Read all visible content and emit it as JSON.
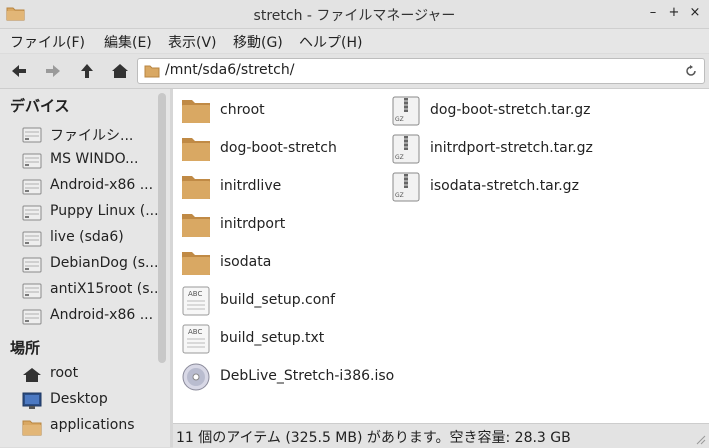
{
  "window": {
    "title": "stretch - ファイルマネージャー",
    "minimize_glyph": "–",
    "maximize_glyph": "+",
    "close_glyph": "×"
  },
  "menu": [
    {
      "label": "ファイル(F)"
    },
    {
      "label": "編集(E)"
    },
    {
      "label": "表示(V)"
    },
    {
      "label": "移動(G)"
    },
    {
      "label": "ヘルプ(H)"
    }
  ],
  "toolbar": {
    "icons": [
      "back-arrow-icon",
      "forward-arrow-icon",
      "up-arrow-icon",
      "home-icon"
    ],
    "path": "/mnt/sda6/stretch/"
  },
  "sidebar": {
    "devices_header": "デバイス",
    "devices": [
      {
        "label": "ファイルシ...",
        "icon": "drive-icon"
      },
      {
        "label": "MS WINDO...",
        "icon": "drive-icon"
      },
      {
        "label": "Android-x86 ...",
        "icon": "drive-icon"
      },
      {
        "label": "Puppy Linux (...",
        "icon": "drive-icon"
      },
      {
        "label": "live (sda6)",
        "icon": "drive-icon"
      },
      {
        "label": "DebianDog (s...",
        "icon": "drive-icon"
      },
      {
        "label": "antiX15root (s...",
        "icon": "drive-icon"
      },
      {
        "label": "Android-x86 ...",
        "icon": "drive-icon"
      }
    ],
    "places_header": "場所",
    "places": [
      {
        "label": "root",
        "icon": "home-icon"
      },
      {
        "label": "Desktop",
        "icon": "desktop-icon"
      },
      {
        "label": "applications",
        "icon": "folder-icon"
      }
    ]
  },
  "files": [
    {
      "name": "chroot",
      "type": "folder"
    },
    {
      "name": "dog-boot-stretch",
      "type": "folder"
    },
    {
      "name": "initrdlive",
      "type": "folder"
    },
    {
      "name": "initrdport",
      "type": "folder"
    },
    {
      "name": "isodata",
      "type": "folder"
    },
    {
      "name": "build_setup.conf",
      "type": "text"
    },
    {
      "name": "build_setup.txt",
      "type": "text"
    },
    {
      "name": "DebLive_Stretch-i386.iso",
      "type": "disc"
    },
    {
      "name": "dog-boot-stretch.tar.gz",
      "type": "archive"
    },
    {
      "name": "initrdport-stretch.tar.gz",
      "type": "archive"
    },
    {
      "name": "isodata-stretch.tar.gz",
      "type": "archive"
    }
  ],
  "icon_text": {
    "text_file": "ABC",
    "archive": "GZ"
  },
  "status": "11 個のアイテム (325.5 MB) があります。空き容量: 28.3 GB",
  "colors": {
    "folder": "#d9a863",
    "folder_dark": "#c08a45",
    "window_bg": "#e6e6e6",
    "content_bg": "#ffffff"
  }
}
